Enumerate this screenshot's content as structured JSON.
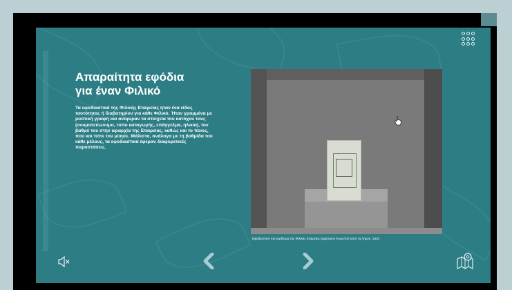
{
  "heading": {
    "line1": "Απαραίτητα εφόδια",
    "line2": "για έναν Φιλικό"
  },
  "body_text": "Τα εφοδιαστικά της Φιλικής Εταιρείας ήταν ένα είδος ταυτότητας ή διαβατηρίου για κάθε Φιλικό. Ήταν γραμμένα με μυστική γραφή και ανέφεραν τα στοιχεία του κατόχου τους (ονοματεπώνυμο, τόπο καταγωγής, επάγγελμα, ηλικία), τον βαθμό του στην ιεραρχία της Εταιρείας, καθώς και το ποιος, πού και πότε τον μύησε. Μάλιστα, ανάλογα με τη βαθμίδα του κάθε μέλους, τα εφοδιαστικά έφεραν διαφορετικές παραστάσεις.",
  "caption": "Εφοδιαστικό του κερδίσμα της Φιλικής Εταιρείας Δημητρίου Κερεντού (από τη Λήμνο. 1820",
  "icons": {
    "menu": "grid-menu-icon",
    "sound": "speaker-muted-icon",
    "prev": "chevron-left-icon",
    "next": "chevron-right-icon",
    "map": "map-pin-icon",
    "cursor": "hand-cursor-icon"
  },
  "colors": {
    "page_bg": "#bccfd2",
    "frame": "#000000",
    "panel": "#2d7d85",
    "icon": "#e8f3f4"
  }
}
